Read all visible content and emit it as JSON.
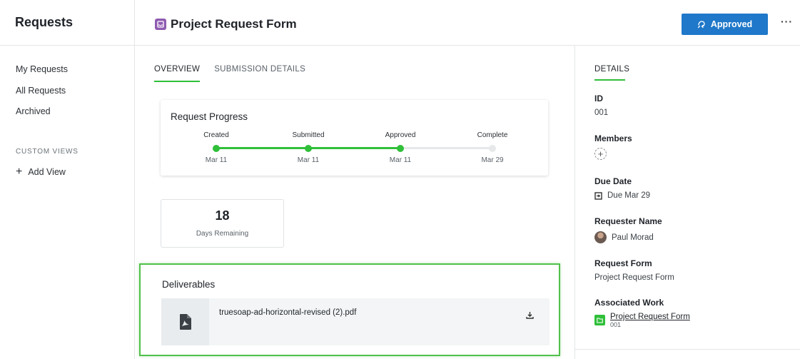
{
  "sidebar": {
    "title": "Requests",
    "items": [
      {
        "label": "My Requests"
      },
      {
        "label": "All Requests"
      },
      {
        "label": "Archived"
      }
    ],
    "custom_views_label": "CUSTOM VIEWS",
    "add_view_label": "Add View"
  },
  "header": {
    "title": "Project Request Form",
    "status_button": "Approved",
    "more_label": "···"
  },
  "tabs": [
    {
      "label": "OVERVIEW",
      "active": true
    },
    {
      "label": "SUBMISSION DETAILS",
      "active": false
    }
  ],
  "progress": {
    "title": "Request Progress",
    "steps": [
      {
        "label": "Created",
        "date": "Mar 11",
        "done": true
      },
      {
        "label": "Submitted",
        "date": "Mar 11",
        "done": true
      },
      {
        "label": "Approved",
        "date": "Mar 11",
        "done": true
      },
      {
        "label": "Complete",
        "date": "Mar 29",
        "done": false
      }
    ]
  },
  "days": {
    "value": "18",
    "label": "Days Remaining"
  },
  "deliverables": {
    "title": "Deliverables",
    "file_name": "truesoap-ad-horizontal-revised (2).pdf"
  },
  "details": {
    "tab_label": "DETAILS",
    "id_label": "ID",
    "id_value": "001",
    "members_label": "Members",
    "due_label": "Due Date",
    "due_value": "Due Mar 29",
    "requester_label": "Requester Name",
    "requester_value": "Paul Morad",
    "form_label": "Request Form",
    "form_value": "Project Request Form",
    "work_label": "Associated Work",
    "work_link": "Project Request Form",
    "work_id": "001"
  },
  "colors": {
    "accent_green": "#2fbf39",
    "primary_blue": "#1f78c9",
    "form_icon_purple": "#8f5bb0"
  }
}
